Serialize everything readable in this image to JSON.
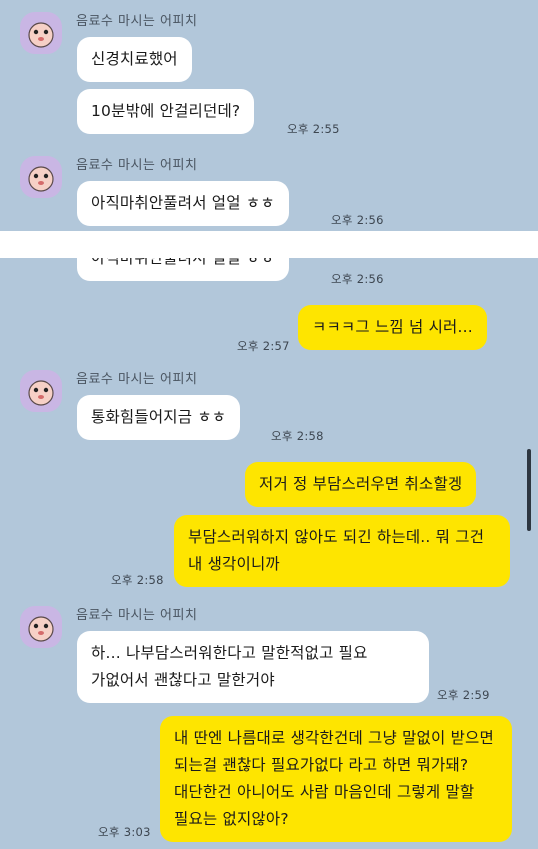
{
  "colors": {
    "chat_background": "#b2c7da",
    "incoming_bubble": "#ffffff",
    "outgoing_bubble": "#fee500",
    "avatar_background": "#c9b6e4"
  },
  "top": {
    "group1": {
      "sender": "음료수 마시는 어피치",
      "messages": [
        "신경치료했어",
        "10분밖에 안걸리던데?"
      ],
      "time": "오후 2:55"
    },
    "group2": {
      "sender": "음료수 마시는 어피치",
      "messages": [
        "아직마취안풀려서 얼얼 ㅎㅎ"
      ],
      "time": "오후 2:56"
    }
  },
  "bottom": {
    "partial_message": "아직마취안풀려서 얼얼 ㅎㅎ",
    "partial_time": "오후 2:56",
    "out1": {
      "text": "ㅋㅋㅋ그 느낌 넘 시러...",
      "time": "오후 2:57"
    },
    "group3": {
      "sender": "음료수 마시는 어피치",
      "messages": [
        "통화힘들어지금 ㅎㅎ"
      ],
      "time": "오후 2:58"
    },
    "out2": {
      "text": "저거 정 부담스러우면 취소할겡"
    },
    "out3": {
      "text": "부담스러워하지 않아도 되긴 하는데.. 뭐 그건 내 생각이니까",
      "time": "오후 2:58"
    },
    "group4": {
      "sender": "음료수 마시는 어피치",
      "messages": [
        "하... 나부담스러워한다고 말한적없고 필요 가없어서 괜찮다고 말한거야"
      ],
      "time": "오후 2:59"
    },
    "out4": {
      "text": "내 딴엔 나름대로 생각한건데 그냥 말없이 받으면 되는걸 괜찮다 필요가없다 라고 하면 뭐가돼? 대단한건 아니어도 사람 마음인데 그렇게 말할 필요는 없지않아?",
      "time": "오후 3:03"
    }
  }
}
